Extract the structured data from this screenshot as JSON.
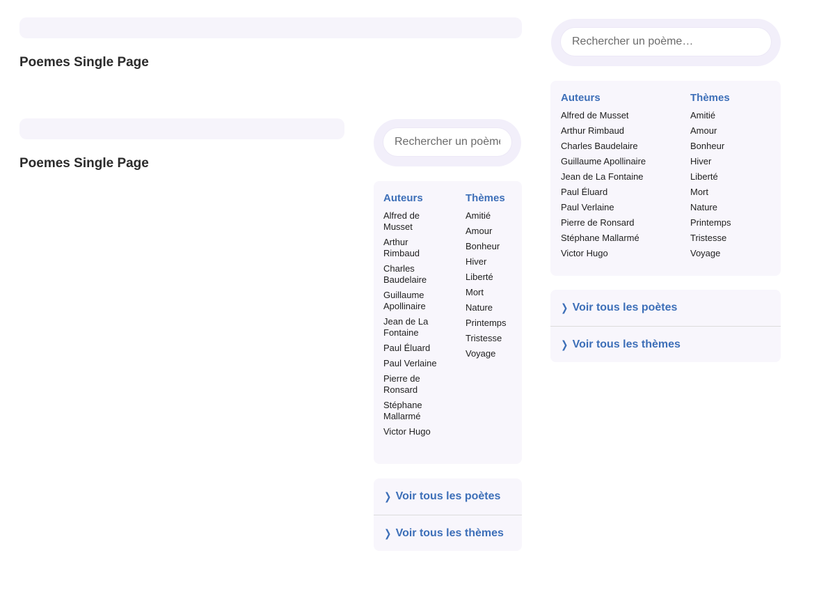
{
  "page": {
    "title": "Poemes Single Page"
  },
  "search": {
    "placeholder": "Rechercher un poème…"
  },
  "sidebar": {
    "authors_heading": "Auteurs",
    "themes_heading": "Thèmes",
    "authors": [
      "Alfred de Musset",
      "Arthur Rimbaud",
      "Charles Baudelaire",
      "Guillaume Apollinaire",
      "Jean de La Fontaine",
      "Paul Éluard",
      "Paul Verlaine",
      "Pierre de Ronsard",
      "Stéphane Mallarmé",
      "Victor Hugo"
    ],
    "themes": [
      "Amitié",
      "Amour",
      "Bonheur",
      "Hiver",
      "Liberté",
      "Mort",
      "Nature",
      "Printemps",
      "Tristesse",
      "Voyage"
    ],
    "see_all_poets": "Voir tous les poètes",
    "see_all_themes": "Voir tous les thèmes"
  },
  "icons": {
    "link_chevron": "chevron-right-icon"
  },
  "colors": {
    "accent": "#3d6fb8",
    "panel_bg": "#f8f6fc",
    "search_halo": "#f2effa"
  }
}
